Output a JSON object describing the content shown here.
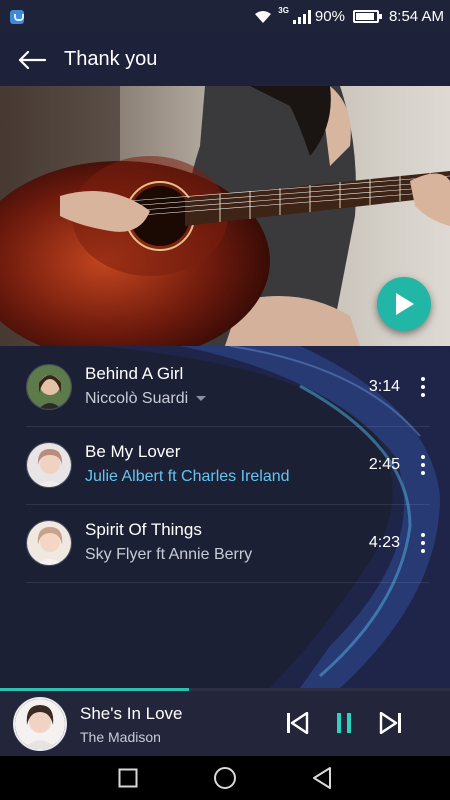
{
  "status_bar": {
    "network": "3G",
    "battery": "90%",
    "time": "8:54 AM"
  },
  "header": {
    "title": "Thank you",
    "back_icon": "arrow-left-icon"
  },
  "tracks": [
    {
      "title": "Behind A Girl",
      "artist": "Niccolò Suardi",
      "duration": "3:14",
      "artist_color": "#c9cbd6",
      "expanded_caret": true
    },
    {
      "title": "Be My Lover",
      "artist": "Julie Albert ft Charles Ireland",
      "duration": "2:45",
      "artist_color": "#64c3f0"
    },
    {
      "title": "Spirit Of Things",
      "artist": "Sky Flyer ft Annie Berry",
      "duration": "4:23",
      "artist_color": "#c9cbd6"
    }
  ],
  "now_playing": {
    "title": "She's In Love",
    "artist": "The Madison",
    "progress": 0.42
  },
  "colors": {
    "accent": "#21b6a5",
    "background": "#1c2035",
    "highlight_artist": "#64c3f0"
  },
  "icons": {
    "play": "play-icon",
    "more": "more-vertical-icon",
    "prev": "skip-previous-icon",
    "pause": "pause-icon",
    "next": "skip-next-icon",
    "nav_recent": "square-icon",
    "nav_home": "circle-icon",
    "nav_back": "triangle-back-icon"
  }
}
